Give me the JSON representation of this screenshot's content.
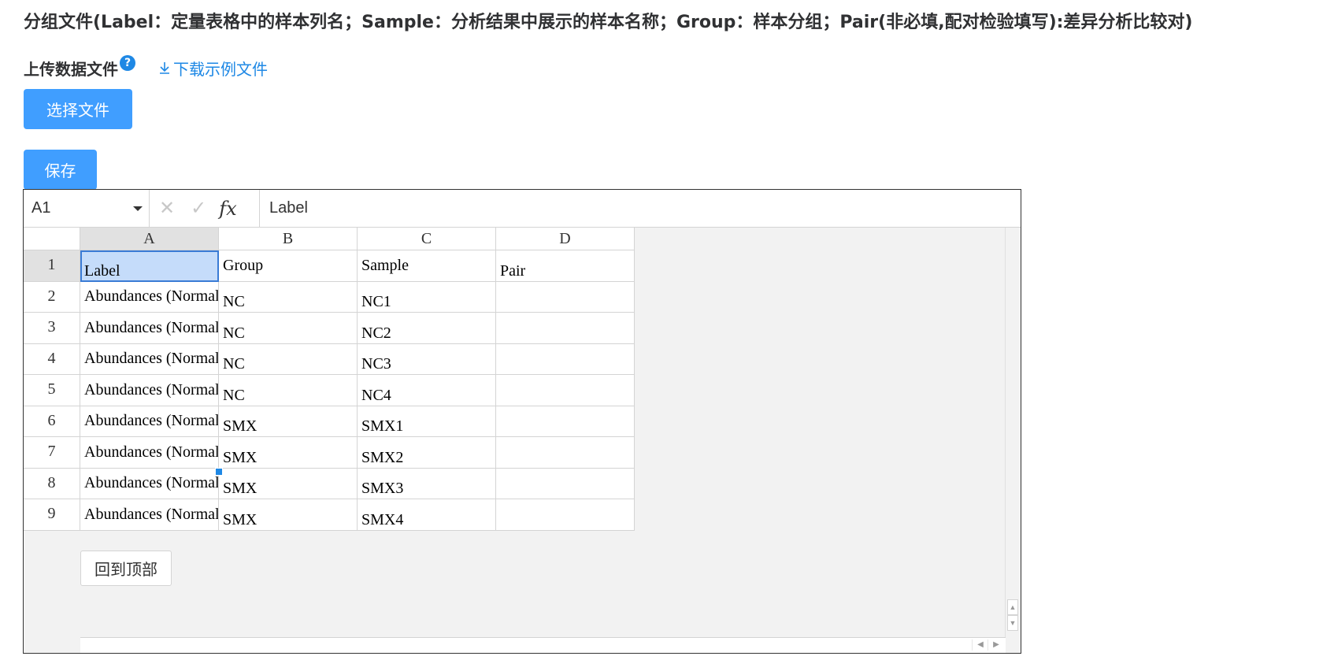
{
  "header": {
    "title": "分组文件(Label：定量表格中的样本列名；Sample：分析结果中展示的样本名称；Group：样本分组；Pair(非必填,配对检验填写):差异分析比较对)"
  },
  "upload": {
    "label": "上传数据文件",
    "help_icon": "?",
    "download_link": "下载示例文件",
    "choose_button": "选择文件",
    "save_button": "保存"
  },
  "sheet": {
    "name_box": "A1",
    "formula_icons": {
      "cancel": "✕",
      "confirm": "✓",
      "fx": "fx"
    },
    "formula_value": "Label",
    "columns": [
      "A",
      "B",
      "C",
      "D"
    ],
    "rows": [
      {
        "num": "1",
        "cells": [
          "Label",
          "Group",
          "Sample",
          "Pair"
        ]
      },
      {
        "num": "2",
        "cells": [
          "Abundances (Normalized)",
          "NC",
          "NC1",
          ""
        ]
      },
      {
        "num": "3",
        "cells": [
          "Abundances (Normalized)",
          "NC",
          "NC2",
          ""
        ]
      },
      {
        "num": "4",
        "cells": [
          "Abundances (Normalized)",
          "NC",
          "NC3",
          ""
        ]
      },
      {
        "num": "5",
        "cells": [
          "Abundances (Normalized)",
          "NC",
          "NC4",
          ""
        ]
      },
      {
        "num": "6",
        "cells": [
          "Abundances (Normalized)",
          "SMX",
          "SMX1",
          ""
        ]
      },
      {
        "num": "7",
        "cells": [
          "Abundances (Normalized)",
          "SMX",
          "SMX2",
          ""
        ]
      },
      {
        "num": "8",
        "cells": [
          "Abundances (Normalized)",
          "SMX",
          "SMX3",
          ""
        ]
      },
      {
        "num": "9",
        "cells": [
          "Abundances (Normalized)",
          "SMX",
          "SMX4",
          ""
        ]
      }
    ],
    "back_to_top": "回到顶部",
    "scroll_glyphs": {
      "up": "▲",
      "down": "▼",
      "left": "◀",
      "right": "▶"
    }
  },
  "colors": {
    "primary": "#409eff",
    "link": "#1e88e5",
    "selection_fill": "#c5dcfa",
    "selection_border": "#3a7bd5"
  }
}
